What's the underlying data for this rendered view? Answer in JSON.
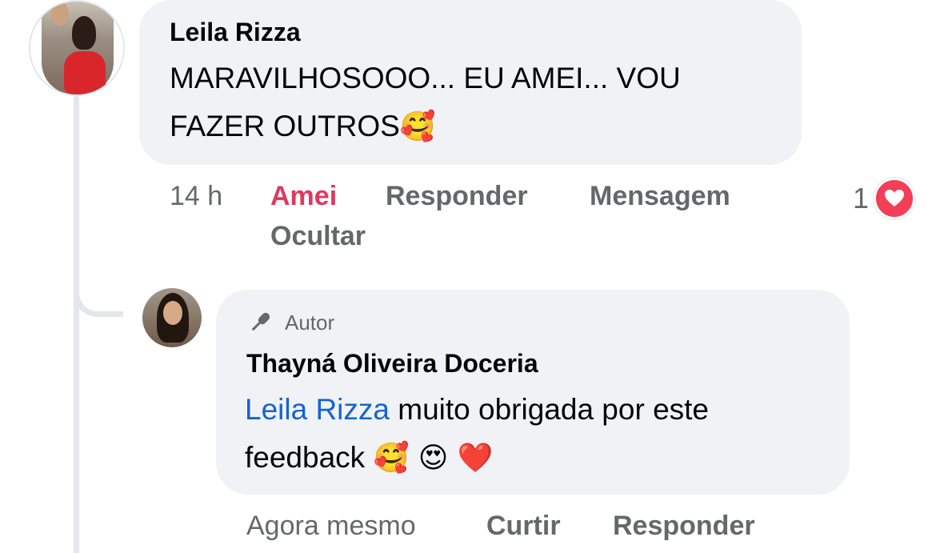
{
  "comment": {
    "author": "Leila Rizza",
    "text_line1": "MARAVILHOSOOO... EU AMEI... VOU",
    "text_line2": "FAZER OUTROS",
    "emoji": "🥰",
    "time": "14 h",
    "action_love": "Amei",
    "action_reply": "Responder",
    "action_message": "Mensagem",
    "action_hide": "Ocultar",
    "reaction_count": "1",
    "reaction_icon": "heart-icon",
    "love_color": "#e2385e"
  },
  "reply": {
    "badge_icon": "microphone-icon",
    "badge_label": "Autor",
    "author": "Thayná Oliveira Doceria",
    "mention": "Leila Rizza",
    "text_part1": " muito obrigada por este",
    "text_part2": "feedback ",
    "emojis": "🥰 😍 ❤️",
    "time": "Agora mesmo",
    "action_like": "Curtir",
    "action_reply": "Responder",
    "mention_color": "#1763cf"
  }
}
